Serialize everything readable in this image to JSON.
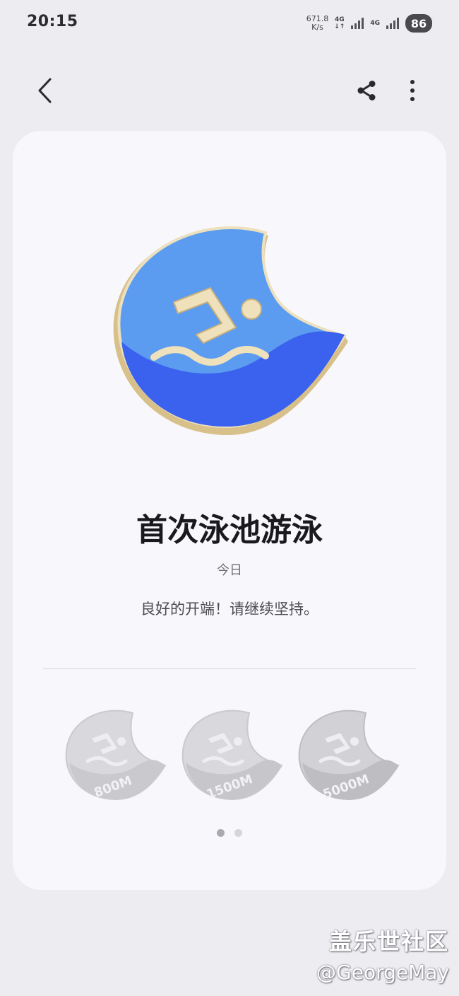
{
  "status_bar": {
    "time": "20:15",
    "net_speed_value": "671.8",
    "net_speed_unit": "K/s",
    "network_1": "4G",
    "network_2": "4G",
    "battery": "86"
  },
  "toolbar": {
    "back_icon": "chevron-left-icon",
    "share_icon": "share-icon",
    "more_icon": "more-vertical-icon"
  },
  "achievement": {
    "title": "首次泳池游泳",
    "date": "今日",
    "message": "良好的开端！请继续坚持。",
    "colors": {
      "light_blue": "#5b9cf0",
      "dark_blue": "#3a62ee",
      "gold": "#e2cf9c"
    }
  },
  "upcoming_badges": [
    {
      "label": "800M"
    },
    {
      "label": "1500M"
    },
    {
      "label": "5000M"
    }
  ],
  "pagination": {
    "total": 2,
    "active": 1
  },
  "watermark": {
    "brand": "盖乐世社区",
    "user": "@GeorgeMay"
  }
}
